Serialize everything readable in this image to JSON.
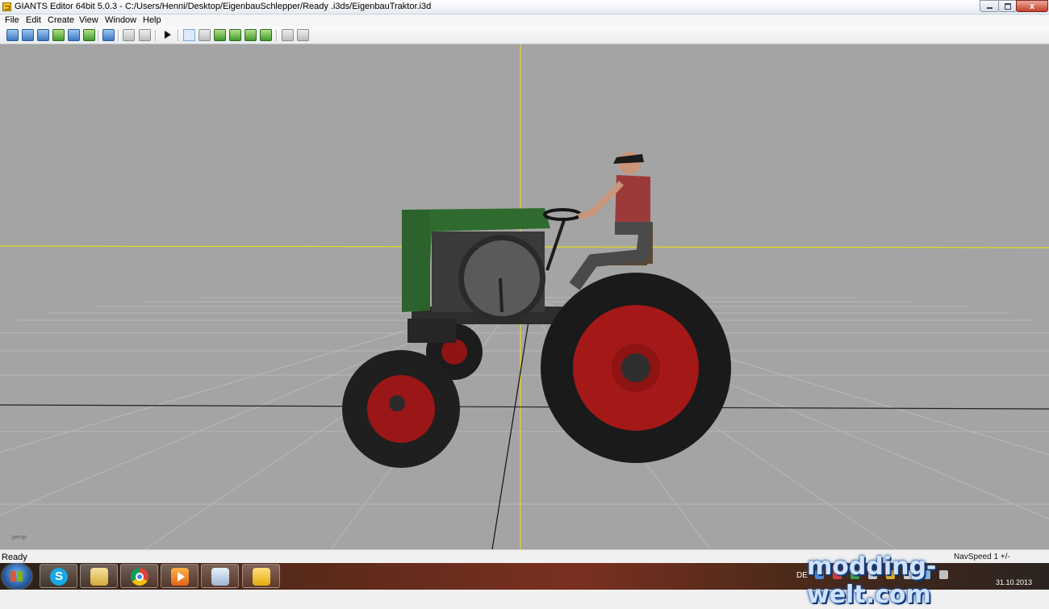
{
  "window": {
    "title": "GIANTS Editor 64bit 5.0.3 - C:/Users/Henni/Desktop/EigenbauSchlepper/Ready .i3ds/EigenbauTraktor.i3d",
    "close_label": "x"
  },
  "menu": {
    "items": [
      "File",
      "Edit",
      "Create",
      "View",
      "Window",
      "Help"
    ]
  },
  "toolbar": {
    "icons": [
      "new-icon",
      "open-icon",
      "import-icon",
      "reload-icon",
      "save-icon",
      "save-as-icon",
      "export-icon",
      "undo-icon",
      "redo-icon",
      "play-icon",
      "select-icon",
      "magnet-icon",
      "terrain-sculpt-icon",
      "terrain-paint-icon",
      "foliage-paint-icon",
      "grass-paint-icon",
      "decal-icon",
      "settings-icon"
    ]
  },
  "viewport": {
    "camera_label": "persp",
    "background_color": "#a4a4a4",
    "axis_color": "#f2e500",
    "grid_color": "#b9b9b9"
  },
  "statusbar": {
    "status": "Ready",
    "nav_speed": "NavSpeed 1 +/-"
  },
  "taskbar": {
    "apps": [
      "skype-icon",
      "explorer-icon",
      "chrome-icon",
      "media-player-icon",
      "paint-icon",
      "giants-editor-icon"
    ],
    "skype_letter": "S",
    "language": "DE",
    "date": "31.10.2013"
  },
  "watermark": "modding-welt.com"
}
